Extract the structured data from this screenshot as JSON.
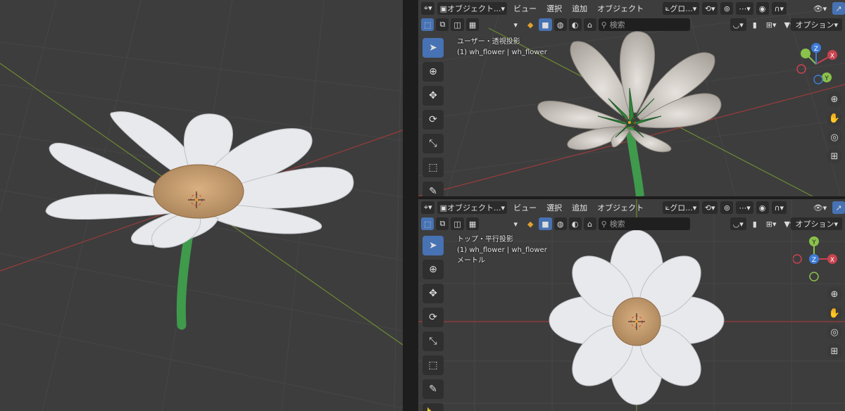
{
  "left_view": {
    "label": ""
  },
  "top_right": {
    "header": {
      "mode_label": "オブジェクト...",
      "menus": [
        "ビュー",
        "選択",
        "追加",
        "オブジェクト"
      ],
      "transform_orientation": "グロ...",
      "search_placeholder": "検索",
      "options_label": "オプション"
    },
    "info": {
      "view_name": "ユーザー・透視投影",
      "object_line": "(1) wh_flower | wh_flower"
    }
  },
  "bottom_right": {
    "header": {
      "mode_label": "オブジェクト...",
      "menus": [
        "ビュー",
        "選択",
        "追加",
        "オブジェクト"
      ],
      "transform_orientation": "グロ...",
      "search_placeholder": "検索",
      "options_label": "オプション"
    },
    "info": {
      "view_name": "トップ・平行投影",
      "object_line": "(1) wh_flower | wh_flower",
      "units": "メートル"
    }
  },
  "gizmo": {
    "x": "X",
    "y": "Y",
    "z": "Z"
  },
  "colors": {
    "accent": "#4772b3",
    "viewport_bg": "#3d3d3d",
    "axis_x": "#c8434f",
    "axis_y": "#8ac24a",
    "axis_z": "#3d7bd8",
    "petal": "#e8e9ec",
    "center": "#c8a070",
    "stem": "#3f9a4c"
  },
  "tools": [
    "select-box-icon",
    "cursor-icon",
    "move-icon",
    "rotate-icon",
    "scale-icon",
    "transform-icon",
    "annotate-icon",
    "measure-icon"
  ],
  "nav_icons": [
    "zoom-icon",
    "hand-icon",
    "camera-icon",
    "grid-icon"
  ]
}
